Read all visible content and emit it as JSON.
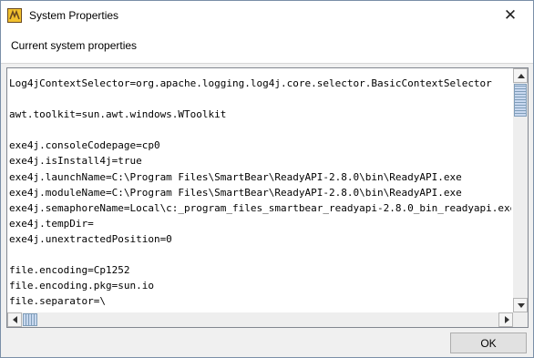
{
  "window": {
    "title": "System Properties",
    "close_glyph": "✕"
  },
  "header": {
    "label": "Current system properties"
  },
  "properties": {
    "lines": [
      "Log4jContextSelector=org.apache.logging.log4j.core.selector.BasicContextSelector",
      "",
      "awt.toolkit=sun.awt.windows.WToolkit",
      "",
      "exe4j.consoleCodepage=cp0",
      "exe4j.isInstall4j=true",
      "exe4j.launchName=C:\\Program Files\\SmartBear\\ReadyAPI-2.8.0\\bin\\ReadyAPI.exe",
      "exe4j.moduleName=C:\\Program Files\\SmartBear\\ReadyAPI-2.8.0\\bin\\ReadyAPI.exe",
      "exe4j.semaphoreName=Local\\c:_program_files_smartbear_readyapi-2.8.0_bin_readyapi.exe",
      "exe4j.tempDir=",
      "exe4j.unextractedPosition=0",
      "",
      "file.encoding=Cp1252",
      "file.encoding.pkg=sun.io",
      "file.separator=\\"
    ]
  },
  "buttons": {
    "ok_label": "OK"
  },
  "icons": {
    "app": "readyapi-app-icon",
    "close": "close-icon"
  },
  "colors": {
    "scroll_thumb": "#c8d8ef",
    "frame_border": "#7a8fa8"
  }
}
